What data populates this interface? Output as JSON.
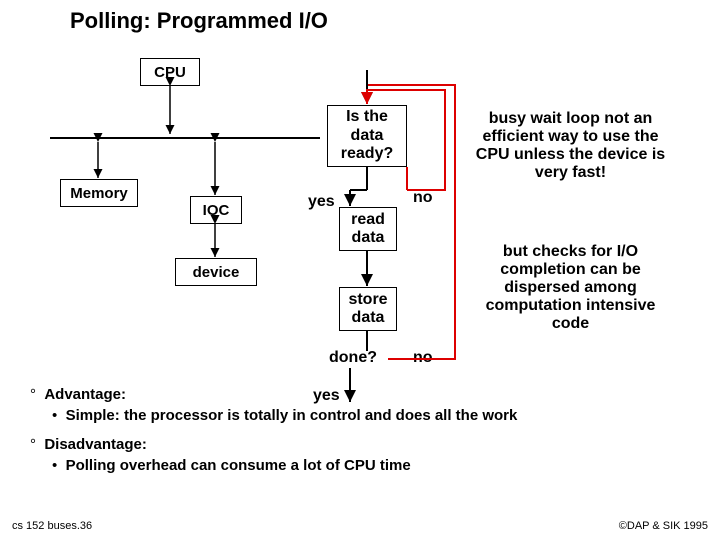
{
  "title": "Polling: Programmed I/O",
  "left": {
    "cpu": "CPU",
    "memory": "Memory",
    "ioc": "IOC",
    "device": "device"
  },
  "flow": {
    "isready_l1": "Is the",
    "isready_l2": "data",
    "isready_l3": "ready?",
    "no1": "no",
    "yes1": "yes",
    "read_l1": "read",
    "read_l2": "data",
    "store_l1": "store",
    "store_l2": "data",
    "done": "done?",
    "no2": "no",
    "yes2": "yes"
  },
  "notes": {
    "p1": "busy wait loop not an efficient way to use the CPU unless the device is very fast!",
    "p2": "but checks for I/O completion can be dispersed among computation intensive code"
  },
  "bullets": {
    "adv_head": "Advantage:",
    "adv_item": "Simple: the processor is totally in control and does all the work",
    "dis_head": "Disadvantage:",
    "dis_item": "Polling overhead can consume a lot of CPU time"
  },
  "footer": {
    "left": "cs 152 buses.36",
    "right": "©DAP & SIK 1995"
  }
}
